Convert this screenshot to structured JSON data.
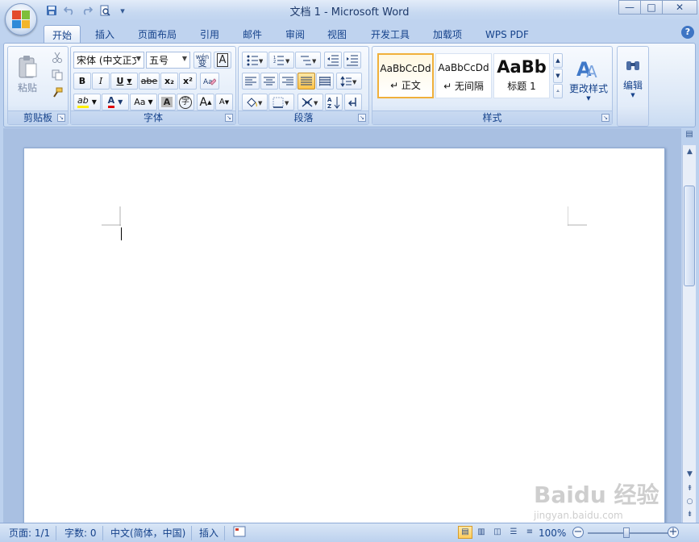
{
  "window": {
    "title": "文档 1 - Microsoft Word",
    "minimize": "—",
    "maximize": "□",
    "close": "✕"
  },
  "qat": {
    "more": "▾"
  },
  "tabs": [
    {
      "label": "开始"
    },
    {
      "label": "插入"
    },
    {
      "label": "页面布局"
    },
    {
      "label": "引用"
    },
    {
      "label": "邮件"
    },
    {
      "label": "审阅"
    },
    {
      "label": "视图"
    },
    {
      "label": "开发工具"
    },
    {
      "label": "加载项"
    },
    {
      "label": "WPS PDF"
    }
  ],
  "help": "?",
  "clipboard": {
    "label": "剪贴板",
    "paste": "粘贴"
  },
  "font": {
    "label": "字体",
    "font_name": "宋体 (中文正文",
    "font_size": "五号",
    "bold": "B",
    "italic": "I",
    "underline": "U",
    "strike": "abe",
    "subscript": "x₂",
    "superscript": "x²",
    "phonetic": "wén",
    "char_border": "A",
    "case": "Aa",
    "char_shade": "A",
    "enclose": "字",
    "grow": "A",
    "shrink": "A",
    "highlight": "ab",
    "font_color": "A"
  },
  "paragraph": {
    "label": "段落"
  },
  "styles": {
    "label": "样式",
    "cards": [
      {
        "sample": "AaBbCcDd",
        "name": "↵ 正文"
      },
      {
        "sample": "AaBbCcDd",
        "name": "↵ 无间隔"
      },
      {
        "sample": "AaBb",
        "name": "标题 1"
      }
    ],
    "change": "更改样式"
  },
  "editing": {
    "label": "编辑"
  },
  "status": {
    "page": "页面: 1/1",
    "words": "字数: 0",
    "language": "中文(简体，中国)",
    "mode": "插入",
    "zoom": "100%",
    "zoom_level": 100
  },
  "watermark": {
    "logo": "Baidu 经验",
    "url": "jingyan.baidu.com"
  },
  "colors": {
    "accent": "#15428b",
    "ribbon": "#dbe7f6",
    "page": "#ffffff"
  }
}
